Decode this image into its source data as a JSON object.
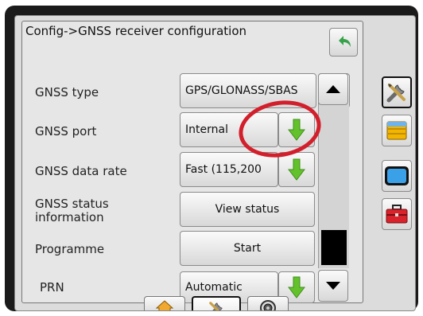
{
  "header": {
    "title": "Config->GNSS receiver configuration"
  },
  "settings": [
    {
      "label": "GNSS type",
      "value": "GPS/GLONASS/SBAS"
    },
    {
      "label": "GNSS port",
      "value": "Internal"
    },
    {
      "label": "GNSS data rate",
      "value": "Fast (115,200"
    },
    {
      "label": "GNSS status\ninformation",
      "value": "View status"
    },
    {
      "label": "Programme",
      "value": "Start"
    },
    {
      "label": "PRN",
      "value": "Automatic"
    }
  ],
  "icons": {
    "back": "back-arrow-icon",
    "next": "right-arrow-icon",
    "dropdown": "down-arrow-icon",
    "scroll_up": "triangle-up-icon",
    "scroll_down": "triangle-down-icon",
    "tools": "tools-icon",
    "files": "file-cabinet-icon",
    "display": "display-icon",
    "toolbox": "toolbox-icon",
    "home": "home-icon",
    "settings": "tools-icon",
    "camera": "camera-icon"
  },
  "colors": {
    "accent_green": "#63c22b",
    "highlight_red": "#d21f2b",
    "back_arrow": "#37a24a"
  }
}
